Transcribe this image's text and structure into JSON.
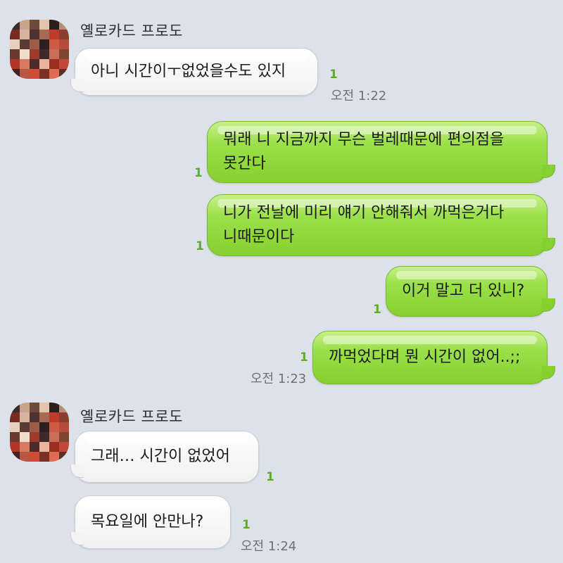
{
  "groups": [
    {
      "sender": "옐로카드 프로도",
      "messages": [
        {
          "lines": [
            "아니 시간이ㅜ없었을수도 있지"
          ],
          "unread": "1",
          "time": "오전 1:22"
        }
      ]
    },
    {
      "sender": "me",
      "messages": [
        {
          "lines": [
            "뭐래 니 지금까지 무슨 벌레때문에 편의점을",
            "못간다"
          ],
          "unread": "1"
        },
        {
          "lines": [
            "니가 전날에 미리 얘기 안해줘서 까먹은거다",
            "니때문이다"
          ],
          "unread": "1"
        },
        {
          "lines": [
            "이거 말고 더 있니?"
          ],
          "unread": "1"
        },
        {
          "lines": [
            "까먹었다며 뭔 시간이 없어..;;"
          ],
          "unread": "1",
          "time": "오전 1:23"
        }
      ]
    },
    {
      "sender": "옐로카드 프로도",
      "messages": [
        {
          "lines": [
            "그래… 시간이 없었어"
          ],
          "unread": "1"
        },
        {
          "lines": [
            "목요일에 안만나?"
          ],
          "unread": "1",
          "time": "오전 1:24"
        }
      ]
    }
  ],
  "colors": {
    "background": "#dde2ea",
    "outgoing_bubble": "#8fd63a",
    "incoming_bubble": "#ffffff",
    "unread_count": "#5fae1f",
    "timestamp": "#6b7079"
  },
  "avatar_icon": "pixelated-profile-photo"
}
